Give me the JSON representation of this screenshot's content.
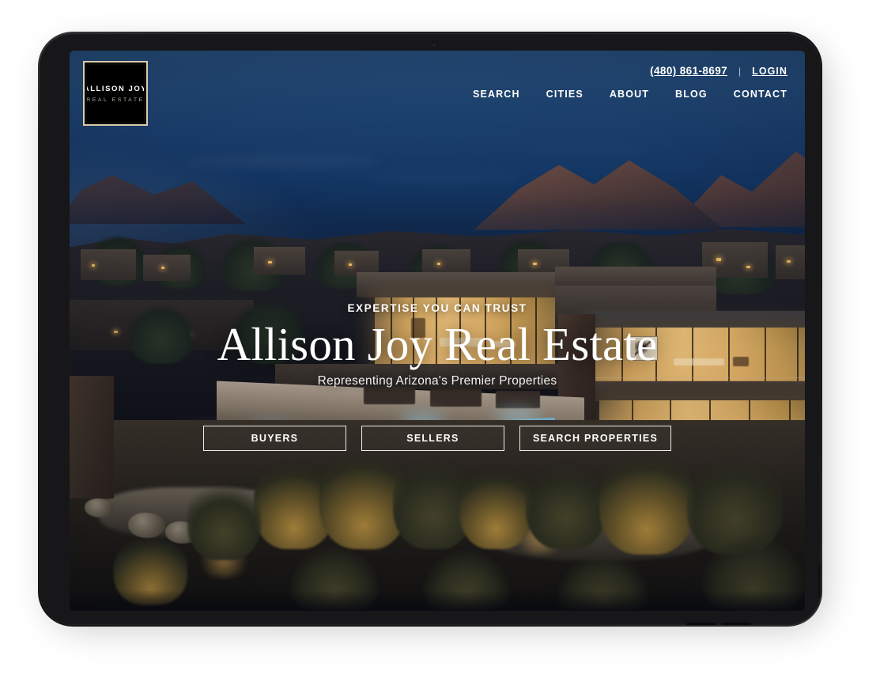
{
  "brand": {
    "logo_line1": "ALLISON JOY",
    "logo_line2": "REAL ESTATE",
    "accent_gold": "#d9cba8",
    "logo_bg": "#000000"
  },
  "topbar": {
    "phone": "(480) 861-8697",
    "separator": "|",
    "login_label": "LOGIN"
  },
  "nav": {
    "items": [
      {
        "label": "SEARCH"
      },
      {
        "label": "CITIES"
      },
      {
        "label": "ABOUT"
      },
      {
        "label": "BLOG"
      },
      {
        "label": "CONTACT"
      }
    ]
  },
  "hero": {
    "kicker": "EXPERTISE YOU CAN TRUST",
    "title": "Allison Joy Real Estate",
    "subtitle": "Representing Arizona's Premier Properties",
    "background_description": "Twilight aerial photo of a modern desert luxury home with lit glass walls, infinity pool and mountain backdrop",
    "sky_color": "#1f4a80",
    "interior_light_color": "#e7bd76",
    "pool_color": "#2a7fba"
  },
  "cta": {
    "buttons": [
      {
        "label": "BUYERS"
      },
      {
        "label": "SELLERS"
      },
      {
        "label": "SEARCH PROPERTIES"
      }
    ]
  },
  "device": {
    "type": "tablet-mockup",
    "frame_color": "#1a1a1c"
  }
}
